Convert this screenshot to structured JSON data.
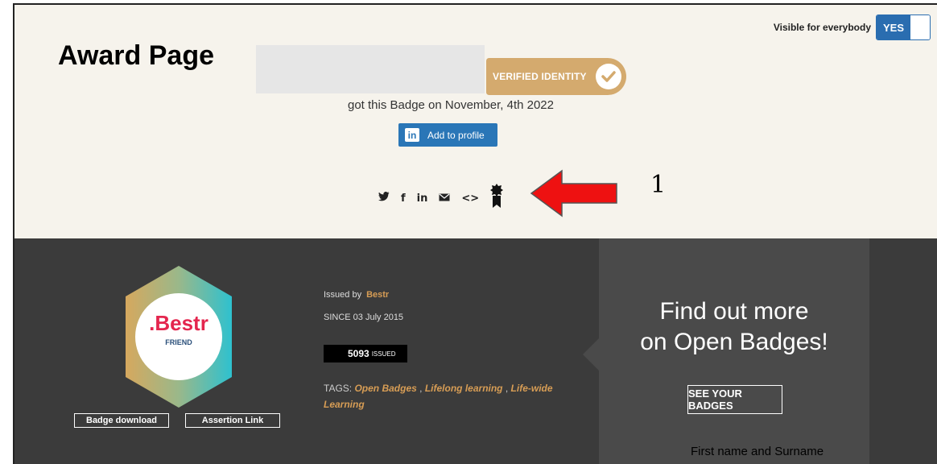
{
  "top": {
    "title": "Award Page",
    "verified_label": "VERIFIED IDENTITY",
    "got_badge_text": "got this Badge on November, 4th 2022",
    "linkedin_button_label": "Add to profile",
    "visibility_label": "Visible for everybody",
    "visibility_toggle_value": "YES",
    "share_icons": [
      "twitter-icon",
      "facebook-icon",
      "linkedin-icon",
      "email-icon",
      "embed-icon",
      "badge-ribbon-icon"
    ],
    "annotation_number": "1"
  },
  "badge": {
    "name": ".Bestr",
    "subtitle": "FRIEND",
    "download_label": "Badge download",
    "assertion_label": "Assertion Link"
  },
  "issuer": {
    "issued_by_label": "Issued by",
    "issuer_name": "Bestr",
    "since_text": "SINCE 03 July 2015",
    "issued_count": "5093",
    "issued_suffix": "ISSUED",
    "tags_label": "TAGS:",
    "tags": [
      "Open Badges",
      "Lifelong learning",
      "Life-wide Learning"
    ]
  },
  "promo": {
    "line1": "Find out more",
    "line2": "on Open Badges!",
    "button_label": "SEE YOUR BADGES"
  },
  "caption": "First name and Surname",
  "colors": {
    "gold": "#d4aa6e",
    "linkedin_blue": "#2a76b7",
    "arrow_red": "#ee1111",
    "dark_bg": "#3b3b3b",
    "light_bg": "#f6f3ec"
  }
}
